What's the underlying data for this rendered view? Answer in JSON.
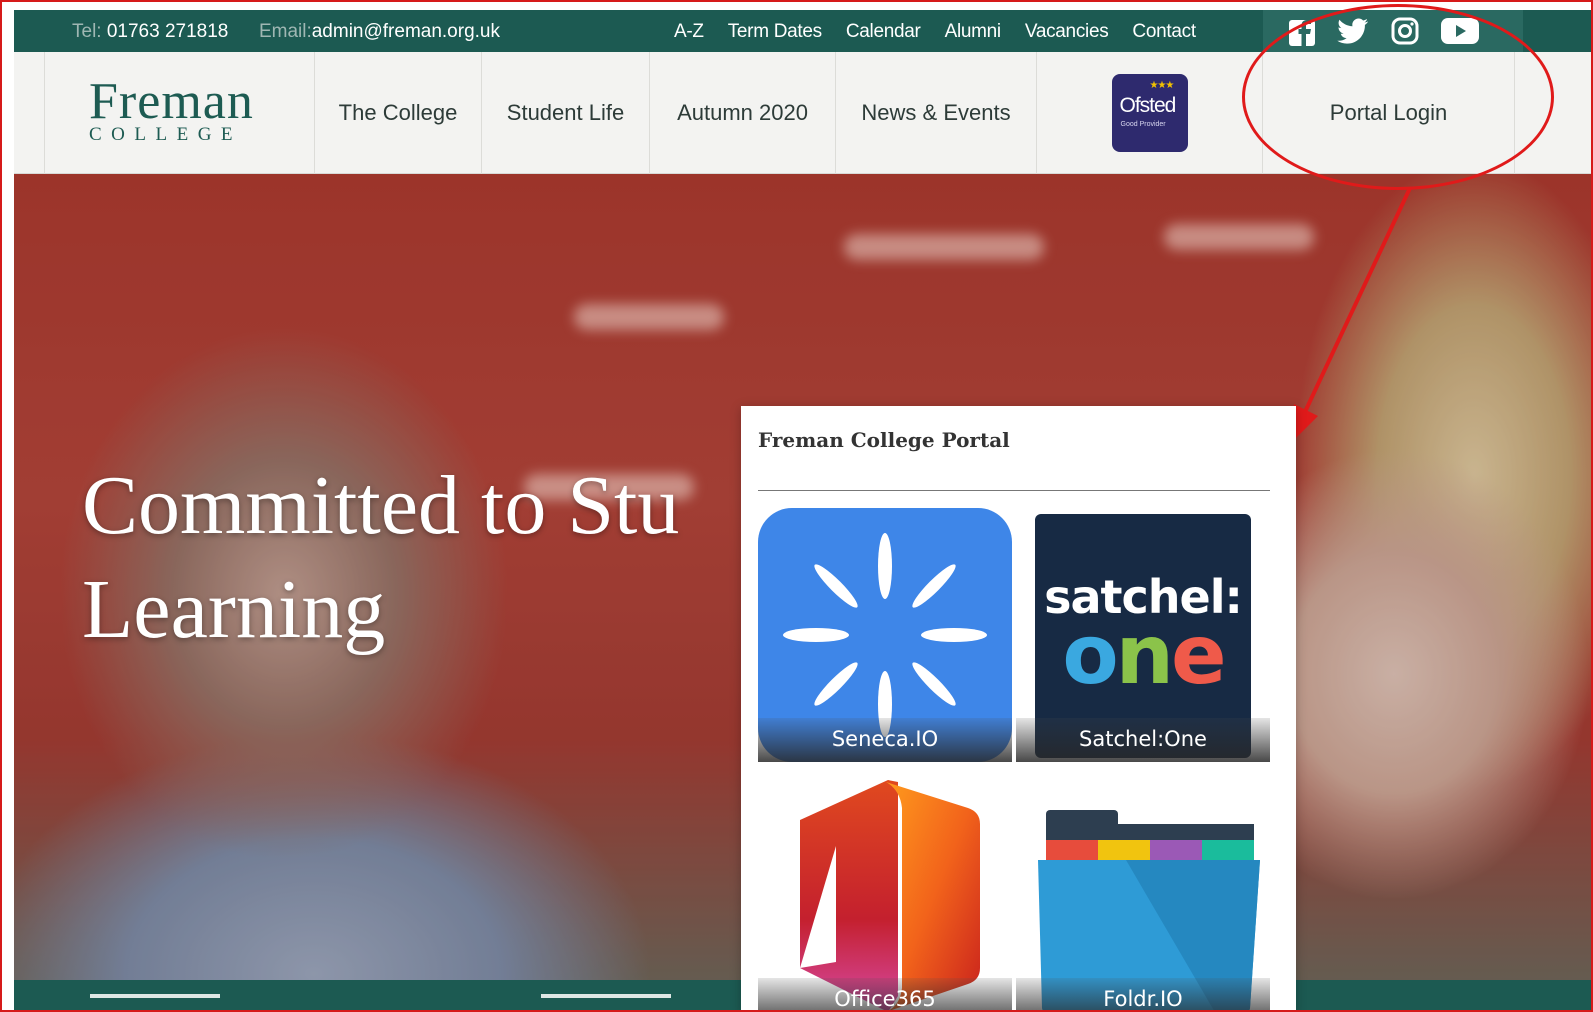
{
  "topbar": {
    "tel_label": "Tel:",
    "tel_value": "01763 271818",
    "email_label": "Email:",
    "email_value": "admin@freman.org.uk",
    "links": [
      "A-Z",
      "Term Dates",
      "Calendar",
      "Alumni",
      "Vacancies",
      "Contact"
    ],
    "social_icons": [
      "facebook-icon",
      "twitter-icon",
      "instagram-icon",
      "youtube-icon"
    ]
  },
  "navbar": {
    "logo_main": "Freman",
    "logo_sub": "COLLEGE",
    "items": [
      "The College",
      "Student Life",
      "Autumn 2020",
      "News & Events"
    ],
    "ofsted_title": "Ofsted",
    "ofsted_sub": "Good Provider",
    "portal_login": "Portal Login"
  },
  "hero": {
    "title_line1": "Committed to Stu",
    "title_line2": "Learning"
  },
  "portal": {
    "title": "Freman College Portal",
    "tiles": [
      {
        "label": "Seneca.IO"
      },
      {
        "label": "Satchel:One",
        "logo_line1": "satchel:",
        "logo_line2": "one"
      },
      {
        "label": "Office365"
      },
      {
        "label": "Foldr.IO"
      }
    ]
  },
  "colors": {
    "brand_green": "#1c5a52",
    "annotation_red": "#e01a1a",
    "ofsted_purple": "#2e2a6e",
    "seneca_blue": "#3e86e8",
    "satchel_navy": "#172a44"
  }
}
